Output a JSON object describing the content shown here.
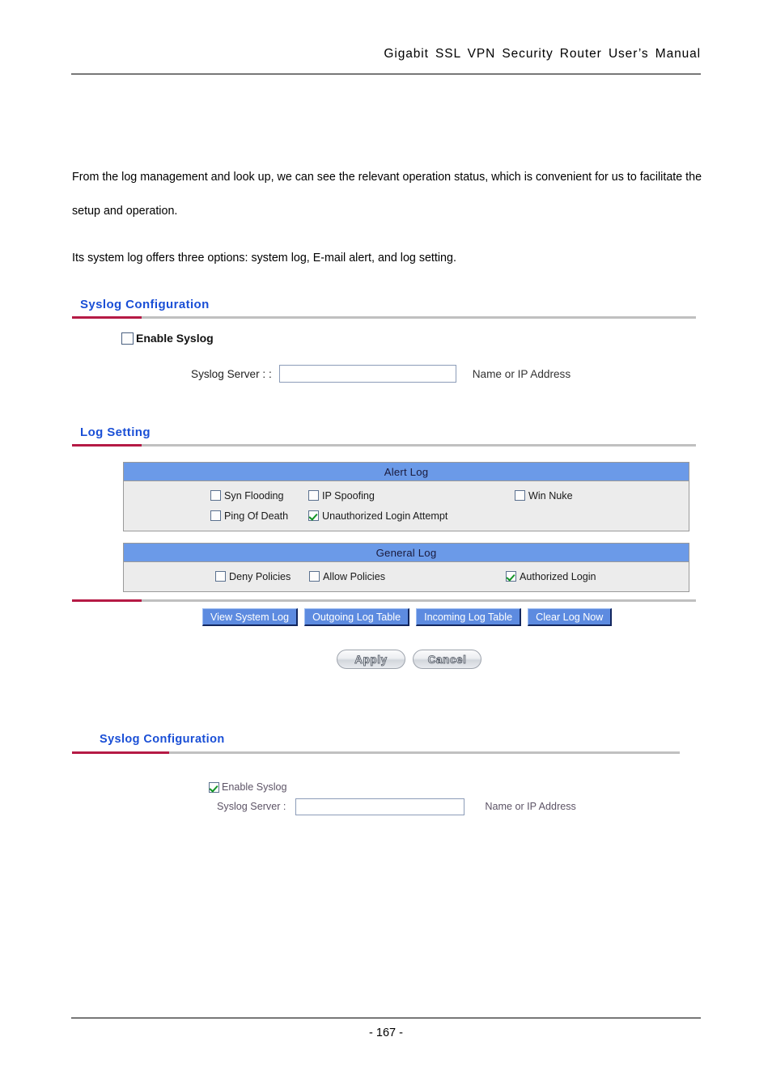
{
  "header": {
    "title": "Gigabit  SSL  VPN  Security  Router  User’s  Manual"
  },
  "body": {
    "paragraph_1": "From the log management and look up, we can see the relevant operation status, which is convenient for us to facilitate the setup and operation.",
    "paragraph_2": "Its system log offers three options: system log, E-mail alert, and log setting."
  },
  "syslog_section_1": {
    "heading": "Syslog Configuration",
    "enable_checkbox_label": "Enable Syslog",
    "enable_checked": false,
    "server_label": "Syslog Server :  :",
    "server_value": "",
    "server_placeholder": "",
    "hint": "Name or IP Address"
  },
  "log_setting": {
    "heading": "Log Setting",
    "alert_log": {
      "title": "Alert Log",
      "rows": [
        [
          {
            "label": "Syn Flooding",
            "checked": false
          },
          {
            "label": "IP Spoofing",
            "checked": false
          },
          {
            "label": "Win Nuke",
            "checked": false
          }
        ],
        [
          {
            "label": "Ping Of Death",
            "checked": false
          },
          {
            "label": "Unauthorized Login Attempt",
            "checked": true
          },
          {
            "label": "",
            "checked": false
          }
        ]
      ]
    },
    "general_log": {
      "title": "General Log",
      "rows": [
        [
          {
            "label": "Deny Policies",
            "checked": false
          },
          {
            "label": "Allow Policies",
            "checked": false
          },
          {
            "label": "Authorized Login",
            "checked": true
          }
        ]
      ]
    },
    "action_buttons": [
      "View System Log",
      "Outgoing Log Table",
      "Incoming Log Table",
      "Clear Log Now"
    ],
    "apply_label": "Apply",
    "cancel_label": "Cancel"
  },
  "syslog_section_2": {
    "heading": "Syslog Configuration",
    "enable_checkbox_label": "Enable Syslog",
    "enable_checked": true,
    "server_label": "Syslog Server :",
    "server_value": "",
    "server_placeholder": "",
    "hint": "Name or IP Address"
  },
  "footer": {
    "page_number": "- 167 -"
  },
  "colors": {
    "heading_blue": "#1a4fd6",
    "accent_crimson": "#b51a45",
    "panel_title_blue": "#6b9ae8",
    "panel_body_gray": "#ececec",
    "button_blue": "#5d8be0",
    "check_green": "#119425"
  }
}
